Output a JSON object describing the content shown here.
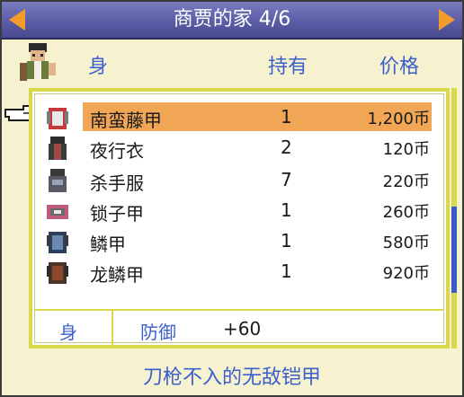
{
  "header": {
    "title": "商贾的家 4/6"
  },
  "columns": {
    "slot": "身",
    "owned": "持有",
    "price": "价格"
  },
  "items": [
    {
      "name": "南蛮藤甲",
      "qty": "1",
      "price": "1,200币",
      "selected": true
    },
    {
      "name": "夜行衣",
      "qty": "2",
      "price": "120币"
    },
    {
      "name": "杀手服",
      "qty": "7",
      "price": "220币"
    },
    {
      "name": "锁子甲",
      "qty": "1",
      "price": "260币"
    },
    {
      "name": "鳞甲",
      "qty": "1",
      "price": "580币"
    },
    {
      "name": "龙鳞甲",
      "qty": "1",
      "price": "920币"
    }
  ],
  "stats": {
    "slot": "身",
    "stat_name": "防御",
    "stat_value": "+60"
  },
  "footer": {
    "description": "刀枪不入的无敌铠甲"
  },
  "colors": {
    "header": "#5b5da6",
    "accent_text": "#3b5fcc",
    "selection": "#f0a655",
    "border": "#d9d84a",
    "arrow": "#f39c2a"
  }
}
